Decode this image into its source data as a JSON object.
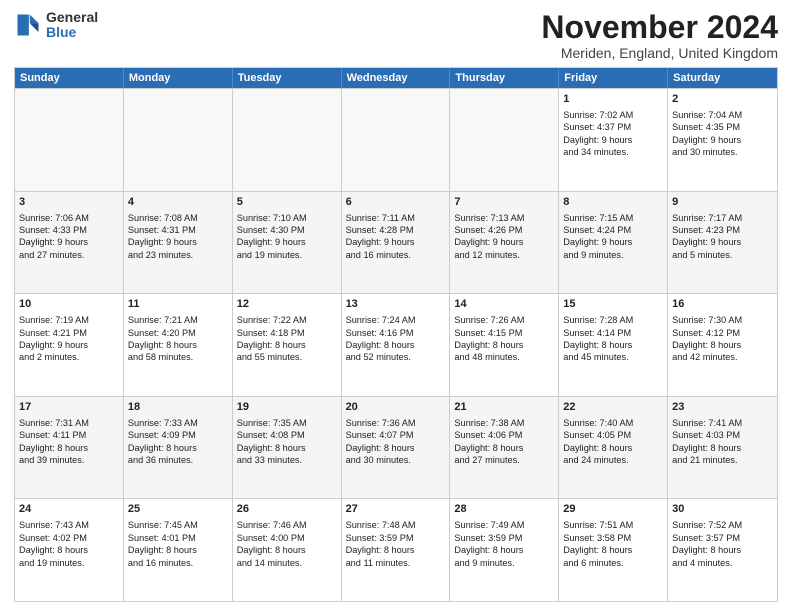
{
  "logo": {
    "general": "General",
    "blue": "Blue"
  },
  "title": "November 2024",
  "location": "Meriden, England, United Kingdom",
  "days": [
    "Sunday",
    "Monday",
    "Tuesday",
    "Wednesday",
    "Thursday",
    "Friday",
    "Saturday"
  ],
  "rows": [
    [
      {
        "day": "",
        "empty": true
      },
      {
        "day": "",
        "empty": true
      },
      {
        "day": "",
        "empty": true
      },
      {
        "day": "",
        "empty": true
      },
      {
        "day": "",
        "empty": true
      },
      {
        "day": "1",
        "lines": [
          "Sunrise: 7:02 AM",
          "Sunset: 4:37 PM",
          "Daylight: 9 hours",
          "and 34 minutes."
        ]
      },
      {
        "day": "2",
        "lines": [
          "Sunrise: 7:04 AM",
          "Sunset: 4:35 PM",
          "Daylight: 9 hours",
          "and 30 minutes."
        ]
      }
    ],
    [
      {
        "day": "3",
        "lines": [
          "Sunrise: 7:06 AM",
          "Sunset: 4:33 PM",
          "Daylight: 9 hours",
          "and 27 minutes."
        ]
      },
      {
        "day": "4",
        "lines": [
          "Sunrise: 7:08 AM",
          "Sunset: 4:31 PM",
          "Daylight: 9 hours",
          "and 23 minutes."
        ]
      },
      {
        "day": "5",
        "lines": [
          "Sunrise: 7:10 AM",
          "Sunset: 4:30 PM",
          "Daylight: 9 hours",
          "and 19 minutes."
        ]
      },
      {
        "day": "6",
        "lines": [
          "Sunrise: 7:11 AM",
          "Sunset: 4:28 PM",
          "Daylight: 9 hours",
          "and 16 minutes."
        ]
      },
      {
        "day": "7",
        "lines": [
          "Sunrise: 7:13 AM",
          "Sunset: 4:26 PM",
          "Daylight: 9 hours",
          "and 12 minutes."
        ]
      },
      {
        "day": "8",
        "lines": [
          "Sunrise: 7:15 AM",
          "Sunset: 4:24 PM",
          "Daylight: 9 hours",
          "and 9 minutes."
        ]
      },
      {
        "day": "9",
        "lines": [
          "Sunrise: 7:17 AM",
          "Sunset: 4:23 PM",
          "Daylight: 9 hours",
          "and 5 minutes."
        ]
      }
    ],
    [
      {
        "day": "10",
        "lines": [
          "Sunrise: 7:19 AM",
          "Sunset: 4:21 PM",
          "Daylight: 9 hours",
          "and 2 minutes."
        ]
      },
      {
        "day": "11",
        "lines": [
          "Sunrise: 7:21 AM",
          "Sunset: 4:20 PM",
          "Daylight: 8 hours",
          "and 58 minutes."
        ]
      },
      {
        "day": "12",
        "lines": [
          "Sunrise: 7:22 AM",
          "Sunset: 4:18 PM",
          "Daylight: 8 hours",
          "and 55 minutes."
        ]
      },
      {
        "day": "13",
        "lines": [
          "Sunrise: 7:24 AM",
          "Sunset: 4:16 PM",
          "Daylight: 8 hours",
          "and 52 minutes."
        ]
      },
      {
        "day": "14",
        "lines": [
          "Sunrise: 7:26 AM",
          "Sunset: 4:15 PM",
          "Daylight: 8 hours",
          "and 48 minutes."
        ]
      },
      {
        "day": "15",
        "lines": [
          "Sunrise: 7:28 AM",
          "Sunset: 4:14 PM",
          "Daylight: 8 hours",
          "and 45 minutes."
        ]
      },
      {
        "day": "16",
        "lines": [
          "Sunrise: 7:30 AM",
          "Sunset: 4:12 PM",
          "Daylight: 8 hours",
          "and 42 minutes."
        ]
      }
    ],
    [
      {
        "day": "17",
        "lines": [
          "Sunrise: 7:31 AM",
          "Sunset: 4:11 PM",
          "Daylight: 8 hours",
          "and 39 minutes."
        ]
      },
      {
        "day": "18",
        "lines": [
          "Sunrise: 7:33 AM",
          "Sunset: 4:09 PM",
          "Daylight: 8 hours",
          "and 36 minutes."
        ]
      },
      {
        "day": "19",
        "lines": [
          "Sunrise: 7:35 AM",
          "Sunset: 4:08 PM",
          "Daylight: 8 hours",
          "and 33 minutes."
        ]
      },
      {
        "day": "20",
        "lines": [
          "Sunrise: 7:36 AM",
          "Sunset: 4:07 PM",
          "Daylight: 8 hours",
          "and 30 minutes."
        ]
      },
      {
        "day": "21",
        "lines": [
          "Sunrise: 7:38 AM",
          "Sunset: 4:06 PM",
          "Daylight: 8 hours",
          "and 27 minutes."
        ]
      },
      {
        "day": "22",
        "lines": [
          "Sunrise: 7:40 AM",
          "Sunset: 4:05 PM",
          "Daylight: 8 hours",
          "and 24 minutes."
        ]
      },
      {
        "day": "23",
        "lines": [
          "Sunrise: 7:41 AM",
          "Sunset: 4:03 PM",
          "Daylight: 8 hours",
          "and 21 minutes."
        ]
      }
    ],
    [
      {
        "day": "24",
        "lines": [
          "Sunrise: 7:43 AM",
          "Sunset: 4:02 PM",
          "Daylight: 8 hours",
          "and 19 minutes."
        ]
      },
      {
        "day": "25",
        "lines": [
          "Sunrise: 7:45 AM",
          "Sunset: 4:01 PM",
          "Daylight: 8 hours",
          "and 16 minutes."
        ]
      },
      {
        "day": "26",
        "lines": [
          "Sunrise: 7:46 AM",
          "Sunset: 4:00 PM",
          "Daylight: 8 hours",
          "and 14 minutes."
        ]
      },
      {
        "day": "27",
        "lines": [
          "Sunrise: 7:48 AM",
          "Sunset: 3:59 PM",
          "Daylight: 8 hours",
          "and 11 minutes."
        ]
      },
      {
        "day": "28",
        "lines": [
          "Sunrise: 7:49 AM",
          "Sunset: 3:59 PM",
          "Daylight: 8 hours",
          "and 9 minutes."
        ]
      },
      {
        "day": "29",
        "lines": [
          "Sunrise: 7:51 AM",
          "Sunset: 3:58 PM",
          "Daylight: 8 hours",
          "and 6 minutes."
        ]
      },
      {
        "day": "30",
        "lines": [
          "Sunrise: 7:52 AM",
          "Sunset: 3:57 PM",
          "Daylight: 8 hours",
          "and 4 minutes."
        ]
      }
    ]
  ]
}
